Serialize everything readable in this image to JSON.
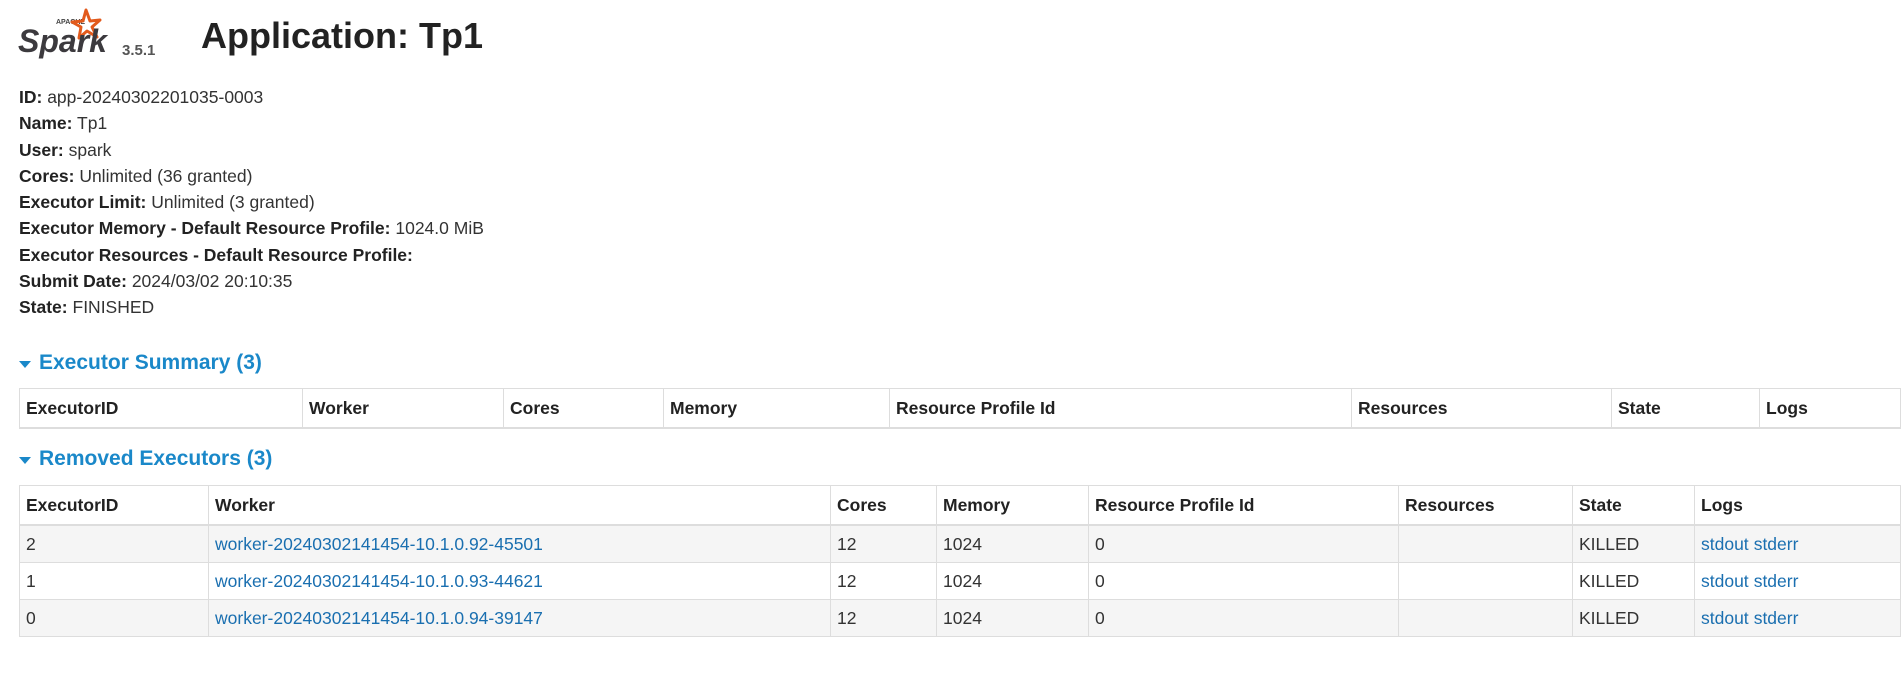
{
  "brand": {
    "logo_text": "Spark",
    "logo_top": "APACHE",
    "version": "3.5.1"
  },
  "title": {
    "prefix": "Application:",
    "name": "Tp1"
  },
  "info": [
    {
      "key": "ID:",
      "value": "app-20240302201035-0003"
    },
    {
      "key": "Name:",
      "value": "Tp1"
    },
    {
      "key": "User:",
      "value": "spark"
    },
    {
      "key": "Cores:",
      "value": "Unlimited (36 granted)"
    },
    {
      "key": "Executor Limit:",
      "value": "Unlimited (3 granted)"
    },
    {
      "key": "Executor Memory - Default Resource Profile:",
      "value": "1024.0 MiB"
    },
    {
      "key": "Executor Resources - Default Resource Profile:",
      "value": ""
    },
    {
      "key": "Submit Date:",
      "value": "2024/03/02 20:10:35"
    },
    {
      "key": "State:",
      "value": "FINISHED"
    }
  ],
  "executor_summary": {
    "heading": "Executor Summary (3)",
    "columns": [
      "ExecutorID",
      "Worker",
      "Cores",
      "Memory",
      "Resource Profile Id",
      "Resources",
      "State",
      "Logs"
    ]
  },
  "removed_executors": {
    "heading": "Removed Executors (3)",
    "columns": [
      "ExecutorID",
      "Worker",
      "Cores",
      "Memory",
      "Resource Profile Id",
      "Resources",
      "State",
      "Logs"
    ],
    "rows": [
      {
        "id": "2",
        "worker": "worker-20240302141454-10.1.0.92-45501",
        "cores": "12",
        "memory": "1024",
        "profile": "0",
        "resources": "",
        "state": "KILLED",
        "stdout": "stdout",
        "stderr": "stderr"
      },
      {
        "id": "1",
        "worker": "worker-20240302141454-10.1.0.93-44621",
        "cores": "12",
        "memory": "1024",
        "profile": "0",
        "resources": "",
        "state": "KILLED",
        "stdout": "stdout",
        "stderr": "stderr"
      },
      {
        "id": "0",
        "worker": "worker-20240302141454-10.1.0.94-39147",
        "cores": "12",
        "memory": "1024",
        "profile": "0",
        "resources": "",
        "state": "KILLED",
        "stdout": "stdout",
        "stderr": "stderr"
      }
    ]
  },
  "colors": {
    "link": "#1a6fb0",
    "section_heading": "#1a88c9",
    "logo_star": "#e25a1c"
  }
}
